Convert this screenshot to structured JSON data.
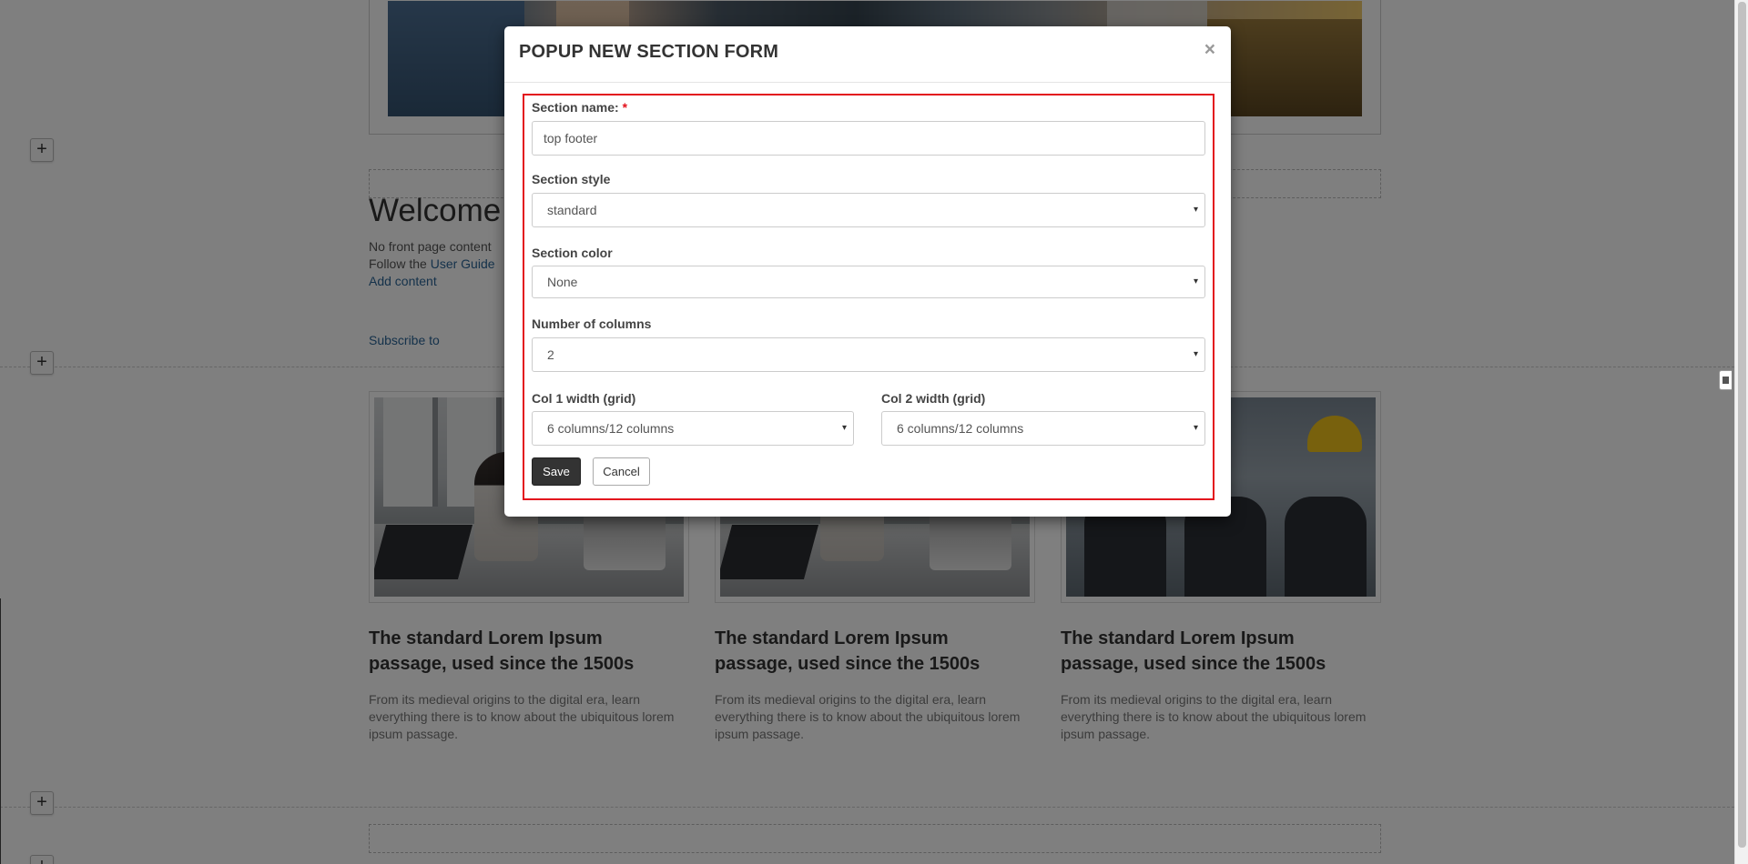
{
  "background": {
    "welcome_heading": "Welcome t",
    "line1": "No front page content",
    "line2_prefix": "Follow the ",
    "line2_link": "User Guide",
    "add_content_link": "Add content",
    "subscribe_link": "Subscribe to",
    "add_section_symbol": "+",
    "cards": [
      {
        "title": "The standard Lorem Ipsum passage, used since the 1500s",
        "description": "From its medieval origins to the digital era, learn everything there is to know about the ubiquitous lorem ipsum passage."
      },
      {
        "title": "The standard Lorem Ipsum passage, used since the 1500s",
        "description": "From its medieval origins to the digital era, learn everything there is to know about the ubiquitous lorem ipsum passage."
      },
      {
        "title": "The standard Lorem Ipsum passage, used since the 1500s",
        "description": "From its medieval origins to the digital era, learn everything there is to know about the ubiquitous lorem ipsum passage."
      }
    ]
  },
  "modal": {
    "title": "POPUP NEW SECTION FORM",
    "close_symbol": "×",
    "accent_color": "#e3121d",
    "fields": {
      "section_name": {
        "label": "Section name:",
        "required_mark": "*",
        "value": "top footer"
      },
      "section_style": {
        "label": "Section style",
        "selected": "standard"
      },
      "section_color": {
        "label": "Section color",
        "selected": "None"
      },
      "num_columns": {
        "label": "Number of columns",
        "selected": "2"
      },
      "col1_width": {
        "label": "Col 1 width (grid)",
        "selected": "6 columns/12 columns"
      },
      "col2_width": {
        "label": "Col 2 width (grid)",
        "selected": "6 columns/12 columns"
      }
    },
    "save_label": "Save",
    "cancel_label": "Cancel"
  },
  "icons": {
    "dropdown_arrow": "▾"
  }
}
